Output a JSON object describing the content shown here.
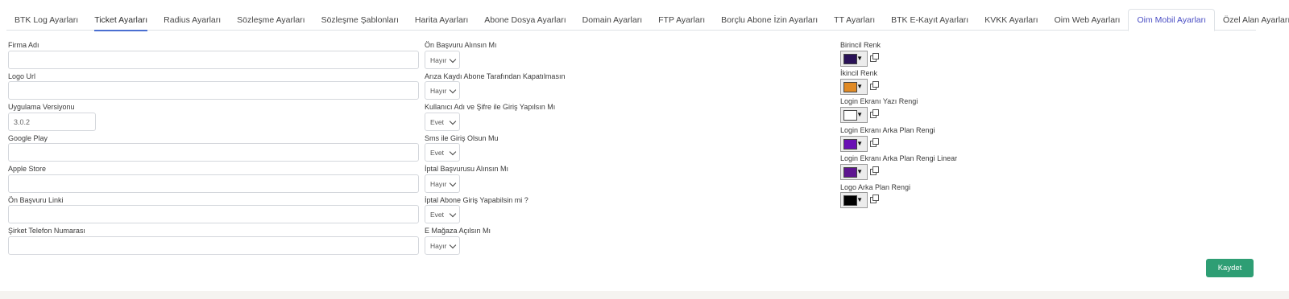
{
  "tabs": [
    {
      "label": "BTK Log Ayarları",
      "state": "normal"
    },
    {
      "label": "Ticket Ayarları",
      "state": "underline"
    },
    {
      "label": "Radius Ayarları",
      "state": "normal"
    },
    {
      "label": "Sözleşme Ayarları",
      "state": "normal"
    },
    {
      "label": "Sözleşme Şablonları",
      "state": "normal"
    },
    {
      "label": "Harita Ayarları",
      "state": "normal"
    },
    {
      "label": "Abone Dosya Ayarları",
      "state": "normal"
    },
    {
      "label": "Domain Ayarları",
      "state": "normal"
    },
    {
      "label": "FTP Ayarları",
      "state": "normal"
    },
    {
      "label": "Borçlu Abone İzin Ayarları",
      "state": "normal"
    },
    {
      "label": "TT Ayarları",
      "state": "normal"
    },
    {
      "label": "BTK E-Kayıt Ayarları",
      "state": "normal"
    },
    {
      "label": "KVKK Ayarları",
      "state": "normal"
    },
    {
      "label": "Oim Web Ayarları",
      "state": "normal"
    },
    {
      "label": "Oim Mobil Ayarları",
      "state": "active"
    },
    {
      "label": "Özel Alan Ayarları",
      "state": "normal"
    }
  ],
  "left_fields": [
    {
      "label": "Firma Adı",
      "value": ""
    },
    {
      "label": "Logo Url",
      "value": ""
    },
    {
      "label": "Uygulama Versiyonu",
      "value": "3.0.2"
    },
    {
      "label": "Google Play",
      "value": ""
    },
    {
      "label": "Apple Store",
      "value": ""
    },
    {
      "label": "Ön Başvuru Linki",
      "value": ""
    },
    {
      "label": "Şirket Telefon Numarası",
      "value": ""
    }
  ],
  "middle_fields": [
    {
      "label": "Ön Başvuru Alınsın Mı",
      "value": "Hayır"
    },
    {
      "label": "Arıza Kaydı Abone Tarafından Kapatılmasın",
      "value": "Hayır"
    },
    {
      "label": "Kullanıcı Adı ve Şifre ile Giriş Yapılsın Mı",
      "value": "Evet"
    },
    {
      "label": "Sms ile Giriş Olsun Mu",
      "value": "Evet"
    },
    {
      "label": "İptal Başvurusu Alınsın Mı",
      "value": "Hayır"
    },
    {
      "label": "İptal Abone Giriş Yapabilsin mi ?",
      "value": "Evet"
    },
    {
      "label": "E Mağaza Açılsın Mı",
      "value": "Hayır"
    }
  ],
  "colors": [
    {
      "label": "Birincil Renk",
      "color": "#2a1258"
    },
    {
      "label": "İkincil Renk",
      "color": "#e08a25"
    },
    {
      "label": "Login Ekranı Yazı Rengi",
      "color": "#ffffff"
    },
    {
      "label": "Login Ekranı Arka Plan Rengi",
      "color": "#6a0fb5"
    },
    {
      "label": "Login Ekranı Arka Plan Rengi Linear",
      "color": "#5e1590"
    },
    {
      "label": "Logo Arka Plan Rengi",
      "color": "#000000"
    }
  ],
  "picker_icons": {
    "arrow": "▼",
    "copy": "copy-icon"
  },
  "save_label": "Kaydet",
  "accent_color": "#4a4ec4",
  "save_color": "#2e9e74"
}
